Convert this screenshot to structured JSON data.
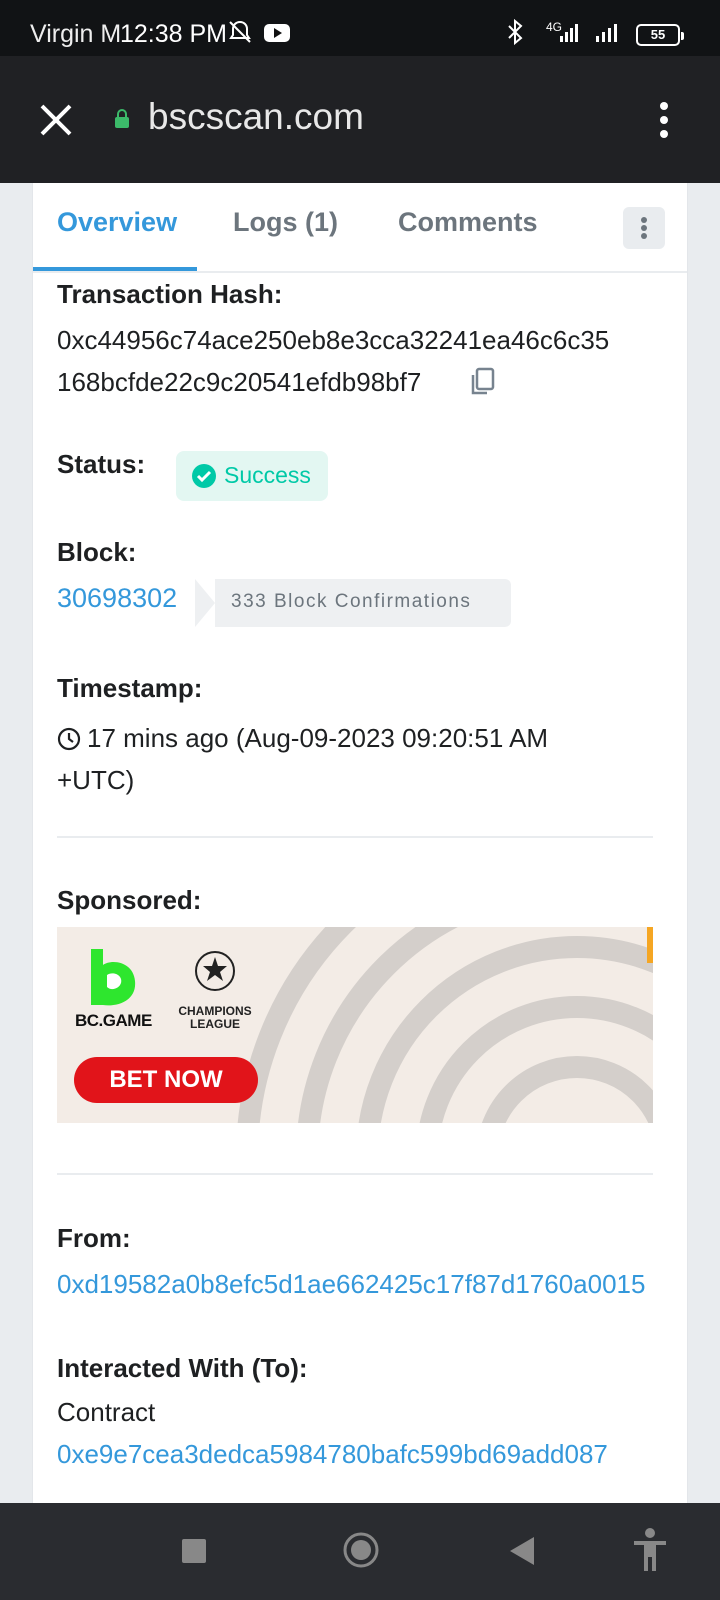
{
  "status_bar": {
    "carrier": "Virgin M",
    "time": "12:38 PM",
    "network": "4G",
    "battery": "55"
  },
  "browser": {
    "url": "bscscan.com"
  },
  "tabs": [
    {
      "label": "Overview",
      "active": true
    },
    {
      "label": "Logs (1)",
      "active": false
    },
    {
      "label": "Comments",
      "active": false
    }
  ],
  "transaction": {
    "hash_label": "Transaction Hash:",
    "hash_line1": "0xc44956c74ace250eb8e3cca32241ea46c6c35",
    "hash_line2": "168bcfde22c9c20541efdb98bf7",
    "status_label": "Status:",
    "status_value": "Success",
    "block_label": "Block:",
    "block_number": "30698302",
    "block_confirmations": "333 Block Confirmations",
    "timestamp_label": "Timestamp:",
    "timestamp_line1": "17 mins ago (Aug-09-2023 09:20:51 AM",
    "timestamp_line2": "+UTC)",
    "sponsored_label": "Sponsored:",
    "from_label": "From:",
    "from_address": "0xd19582a0b8efc5d1ae662425c17f87d1760a0015",
    "to_label": "Interacted With (To):",
    "to_prefix": "Contract",
    "to_address": "0xe9e7cea3dedca5984780bafc599bd69add087"
  },
  "ad": {
    "brand": "BC.GAME",
    "partner": "CHAMPIONS LEAGUE",
    "cta": "BET NOW"
  },
  "colors": {
    "accent": "#3498db",
    "success": "#00c9a7",
    "ad_cta": "#e1141a"
  }
}
